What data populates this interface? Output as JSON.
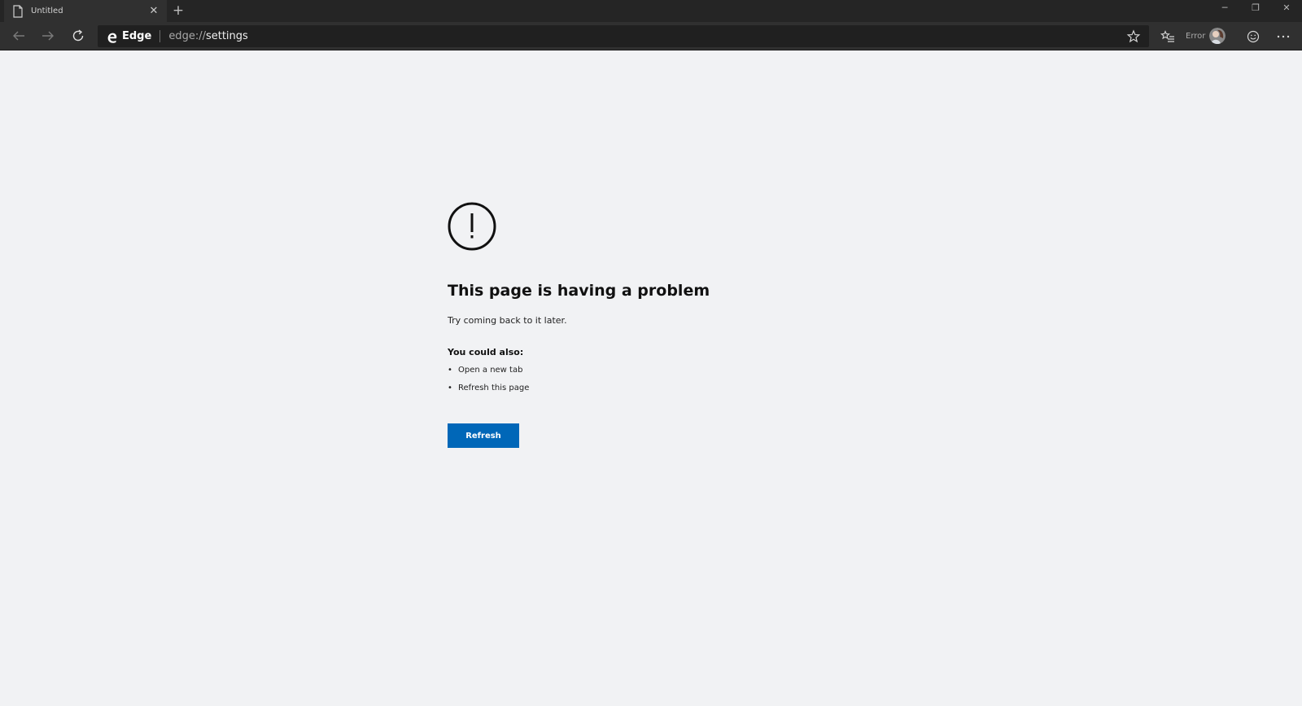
{
  "tab": {
    "title": "Untitled",
    "close_glyph": "✕",
    "new_tab_glyph": "+"
  },
  "window_controls": {
    "minimize": "─",
    "restore": "❐",
    "close": "✕"
  },
  "address_bar": {
    "brand": "Edge",
    "url_scheme": "edge://",
    "url_path": "settings"
  },
  "profile": {
    "label": "Error"
  },
  "error_page": {
    "heading": "This page is having a problem",
    "subtitle": "Try coming back to it later.",
    "suggestions_heading": "You could also:",
    "suggestions": [
      "Open a new tab",
      "Refresh this page"
    ],
    "button_label": "Refresh",
    "bullet": "•"
  },
  "icons": {
    "tab": "page-icon",
    "back": "back-arrow-icon",
    "forward": "forward-arrow-icon",
    "reload": "reload-icon",
    "logo": "edge-logo-icon",
    "favorite": "star-icon",
    "favorites": "favorites-list-icon",
    "feedback": "smiley-icon",
    "menu": "more-icon",
    "error": "exclamation-circle-icon"
  },
  "colors": {
    "page_background": "#f1f2f4",
    "chrome_dark": "#252525",
    "toolbar": "#303030",
    "primary_button": "#0067b8"
  }
}
